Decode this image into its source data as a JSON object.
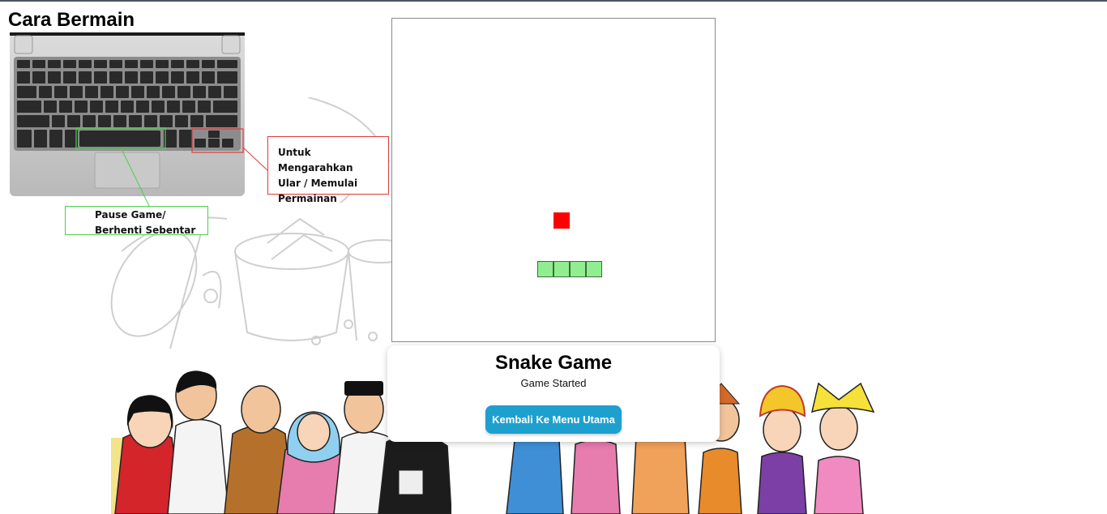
{
  "instructions": {
    "title": "Cara Bermain",
    "arrow_keys_caption": "Untuk Mengarahkan Ular / Memulai Permainan",
    "arrow_keys_lines": [
      "Untuk Mengarahkan",
      "Ular / Memulai",
      "Permainan"
    ],
    "space_caption_lines": [
      "Pause Game/",
      "Berhenti Sebentar"
    ]
  },
  "game": {
    "title": "Snake Game",
    "status": "Game Started",
    "grid_columns": 20,
    "grid_rows": 20,
    "food": {
      "col": 10,
      "row": 12
    },
    "snake": [
      {
        "col": 9,
        "row": 15
      },
      {
        "col": 10,
        "row": 15
      },
      {
        "col": 11,
        "row": 15
      },
      {
        "col": 12,
        "row": 15
      }
    ]
  },
  "actions": {
    "back_to_menu_label": "Kembali Ke Menu Utama"
  },
  "colors": {
    "snake": "#90ee90",
    "food": "#ff0000",
    "button": "#1ea0cf",
    "arrow_callout_border": "#e23a3a",
    "space_callout_border": "#4bd14b"
  }
}
